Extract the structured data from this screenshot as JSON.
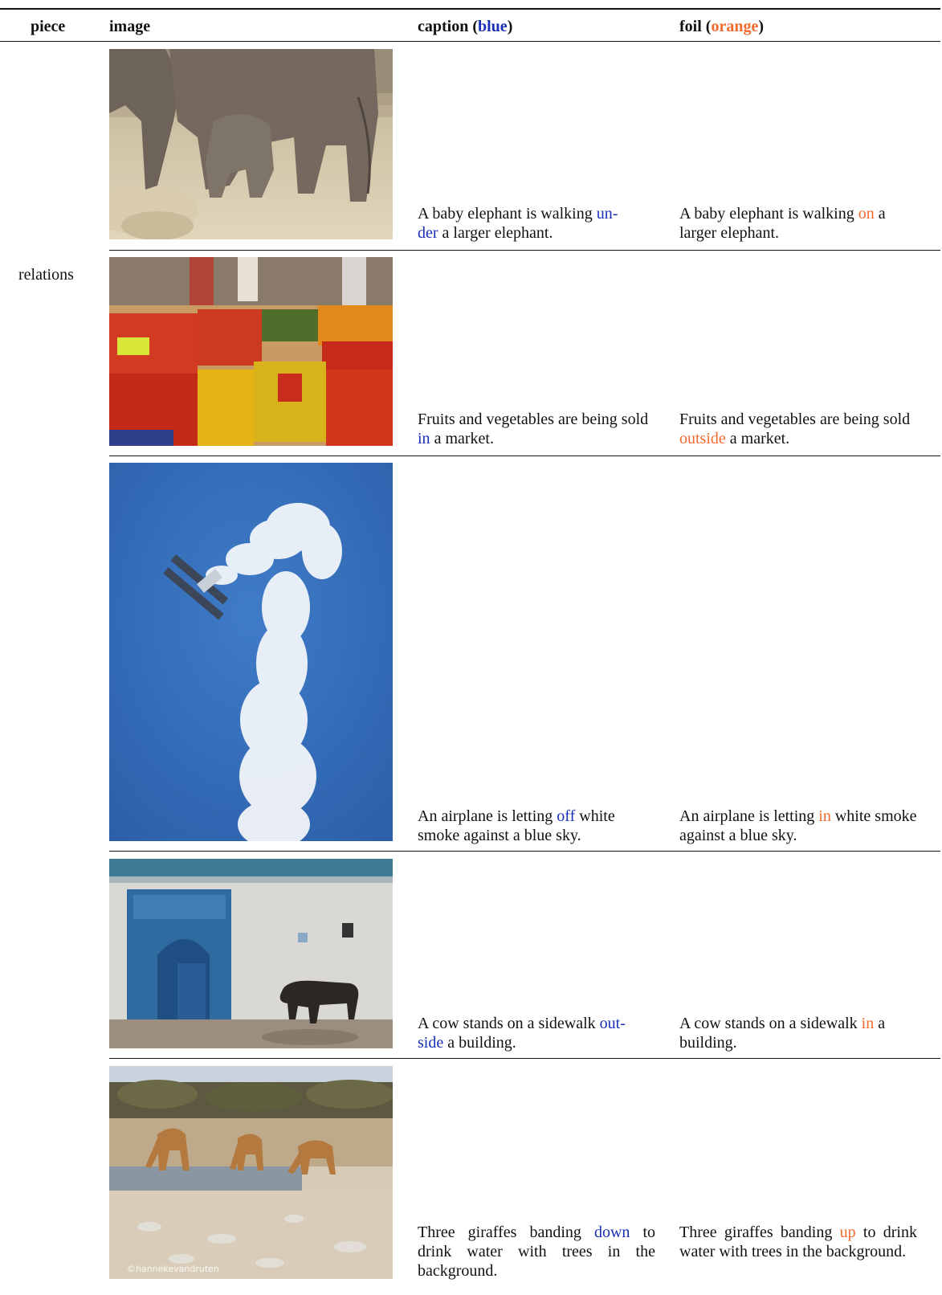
{
  "header": {
    "piece": "piece",
    "image": "image",
    "caption_pre": "caption (",
    "caption_color": "blue",
    "caption_post": ")",
    "foil_pre": "foil (",
    "foil_color": "orange",
    "foil_post": ")"
  },
  "piece_label": "relations",
  "rows": [
    {
      "image_name": "elephants-photo",
      "caption": {
        "pre": "A baby elephant is walking ",
        "word1": "un-",
        "word2": "der",
        "post": " a larger elephant."
      },
      "foil": {
        "pre": "A baby elephant is walking ",
        "word": "on",
        "post": " a larger elephant."
      }
    },
    {
      "image_name": "market-photo",
      "caption": {
        "pre": "Fruits and vegetables are being sold ",
        "word": "in",
        "post": " a market."
      },
      "foil": {
        "pre": "Fruits and vegetables are being sold ",
        "word": "outside",
        "post": " a market."
      }
    },
    {
      "image_name": "airplane-photo",
      "caption": {
        "pre": "An airplane is letting ",
        "word": "off",
        "post": " white smoke against a blue sky."
      },
      "foil": {
        "pre": "An airplane is letting ",
        "word": "in",
        "post": " white smoke against a blue sky."
      }
    },
    {
      "image_name": "cow-photo",
      "caption": {
        "pre": "A cow stands on a sidewalk ",
        "word1": "out-",
        "word2": "side",
        "post": " a building."
      },
      "foil": {
        "pre": "A cow stands on a sidewalk ",
        "word": "in",
        "post": " a building."
      }
    },
    {
      "image_name": "giraffes-photo",
      "caption": {
        "pre": "Three giraffes banding ",
        "word": "down",
        "post": " to drink water with trees in the background."
      },
      "foil": {
        "pre": "Three giraffes banding ",
        "word": "up",
        "post": " to drink water with trees in the background."
      },
      "watermark": "©hannekevandruten"
    }
  ],
  "colors": {
    "blue": "#1a2fb8",
    "orange": "#f26a2e"
  }
}
